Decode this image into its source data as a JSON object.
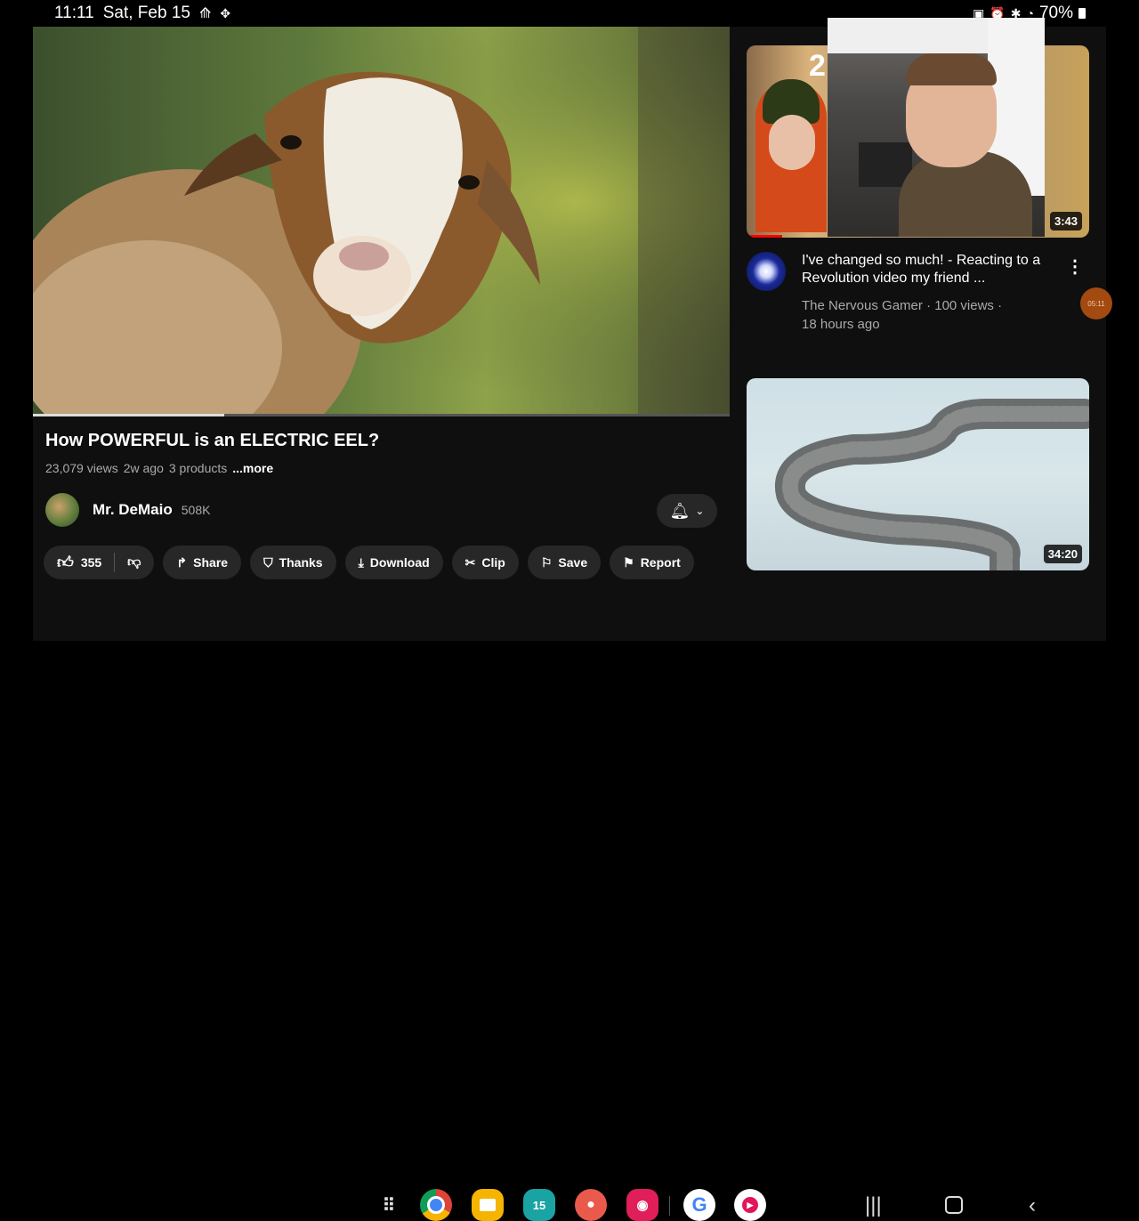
{
  "status_bar": {
    "time": "11:11",
    "date": "Sat, Feb 15",
    "battery": "70%"
  },
  "video": {
    "title": "How POWERFUL is an ELECTRIC EEL?",
    "views": "23,079 views",
    "age": "2w ago",
    "products": "3 products",
    "more": "...more",
    "progress": 0.275
  },
  "channel": {
    "name": "Mr. DeMaio",
    "subscribers": "508K"
  },
  "actions": {
    "like_count": "355",
    "share": "Share",
    "thanks": "Thanks",
    "download": "Download",
    "clip": "Clip",
    "save": "Save",
    "report": "Report"
  },
  "related": [
    {
      "title": "I've changed so much! - Reacting to a Revolution video my friend ...",
      "channel": "The Nervous Gamer",
      "views": "100 views",
      "age": "18 hours ago",
      "duration": "3:43",
      "thumb_overlay_text": "2"
    },
    {
      "title": "",
      "duration": "34:20"
    }
  ],
  "floating_bubble": "05:11",
  "dock_apps": [
    "apps-grid",
    "chrome",
    "files",
    "calendar",
    "contacts",
    "camera",
    "google",
    "youtube"
  ],
  "dock_calendar_day": "15",
  "colors": {
    "background": "#0f0f0f",
    "pill": "#272727",
    "secondary_text": "#aaaaaa"
  }
}
